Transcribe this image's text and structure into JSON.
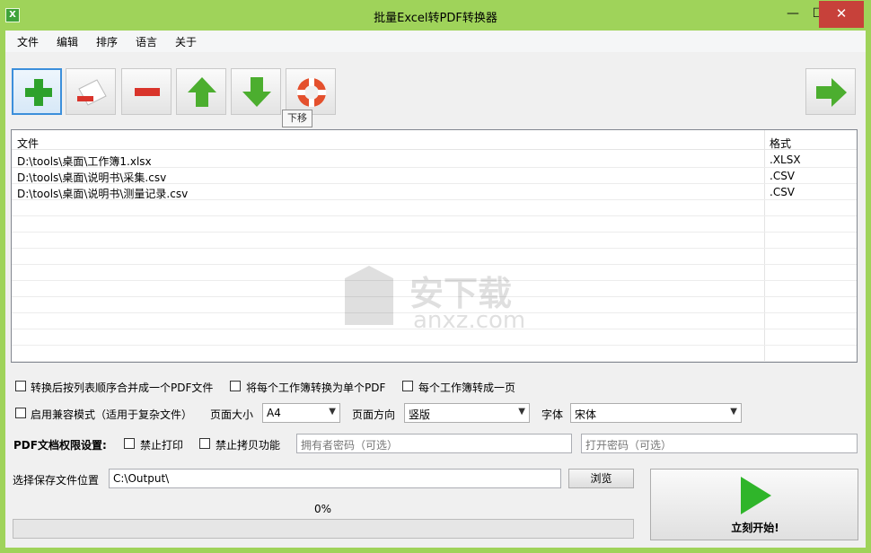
{
  "window": {
    "title": "批量Excel转PDF转换器",
    "app_icon": "excel-icon",
    "controls": {
      "minimize": "—",
      "maximize": "☐",
      "close": "✕"
    }
  },
  "menu": [
    "文件",
    "编辑",
    "排序",
    "语言",
    "关于"
  ],
  "toolbar": {
    "tooltip": "下移",
    "buttons": [
      "add-icon",
      "clear-icon",
      "remove-icon",
      "move-up-icon",
      "move-down-icon",
      "help-icon",
      "next-icon"
    ]
  },
  "file_list": {
    "columns": [
      "文件",
      "格式"
    ],
    "rows": [
      {
        "path": "D:\\tools\\桌面\\工作簿1.xlsx",
        "format": ".XLSX"
      },
      {
        "path": "D:\\tools\\桌面\\说明书\\采集.csv",
        "format": ".CSV"
      },
      {
        "path": "D:\\tools\\桌面\\说明书\\测量记录.csv",
        "format": ".CSV"
      }
    ],
    "watermark_text": "安下载",
    "watermark_sub": "anxz.com"
  },
  "options": {
    "merge_label": "转换后按列表顺序合并成一个PDF文件",
    "each_workbook_label": "将每个工作簿转换为单个PDF",
    "one_page_label": "每个工作簿转成一页",
    "compat_label": "启用兼容模式（适用于复杂文件）",
    "page_size_label": "页面大小",
    "page_size_value": "A4",
    "orientation_label": "页面方向",
    "orientation_value": "竖版",
    "font_label": "字体",
    "font_value": "宋体"
  },
  "permissions": {
    "heading": "PDF文档权限设置:",
    "no_print_label": "禁止打印",
    "no_copy_label": "禁止拷贝功能",
    "owner_pw_placeholder": "拥有者密码（可选）",
    "open_pw_placeholder": "打开密码（可选）"
  },
  "output": {
    "label": "选择保存文件位置",
    "path": "C:\\Output\\",
    "browse_label": "浏览"
  },
  "progress": {
    "text": "0%",
    "value": 0
  },
  "start_button": {
    "label": "立刻开始!"
  }
}
